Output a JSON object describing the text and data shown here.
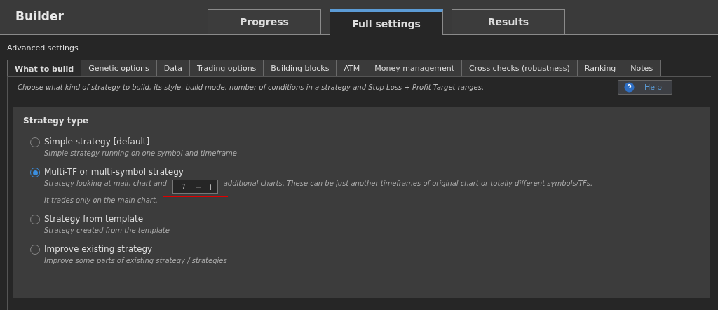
{
  "header": {
    "title": "Builder"
  },
  "main_tabs": [
    {
      "label": "Progress",
      "selected": false
    },
    {
      "label": "Full settings",
      "selected": true
    },
    {
      "label": "Results",
      "selected": false
    }
  ],
  "section_label": "Advanced settings",
  "sub_tabs": [
    {
      "label": "What to build",
      "selected": true
    },
    {
      "label": "Genetic options",
      "selected": false
    },
    {
      "label": "Data",
      "selected": false
    },
    {
      "label": "Trading options",
      "selected": false
    },
    {
      "label": "Building blocks",
      "selected": false
    },
    {
      "label": "ATM",
      "selected": false
    },
    {
      "label": "Money management",
      "selected": false
    },
    {
      "label": "Cross checks (robustness)",
      "selected": false
    },
    {
      "label": "Ranking",
      "selected": false
    },
    {
      "label": "Notes",
      "selected": false
    }
  ],
  "intro": "Choose what kind of strategy to build, its style, build mode, number of conditions in a strategy and Stop Loss + Profit Target ranges.",
  "help_button": "Help",
  "strategy_type": {
    "title": "Strategy type",
    "options": [
      {
        "kind": "plain",
        "label": "Simple strategy [default]",
        "selected": false,
        "description": "Simple strategy running on one symbol and timeframe"
      },
      {
        "kind": "spinner",
        "label": "Multi-TF or multi-symbol strategy",
        "selected": true,
        "description_before": "Strategy looking at main chart and",
        "spinner": {
          "value": "1",
          "minus": "−",
          "plus": "+"
        },
        "description_after": "additional charts. These can be just another timeframes of original chart or totally different symbols/TFs.",
        "description_line2": "It trades only on the main chart."
      },
      {
        "kind": "plain",
        "label": "Strategy from template",
        "selected": false,
        "description": "Strategy created from the template"
      },
      {
        "kind": "plain",
        "label": "Improve existing strategy",
        "selected": false,
        "description": "Improve some parts of existing strategy / strategies"
      }
    ]
  }
}
